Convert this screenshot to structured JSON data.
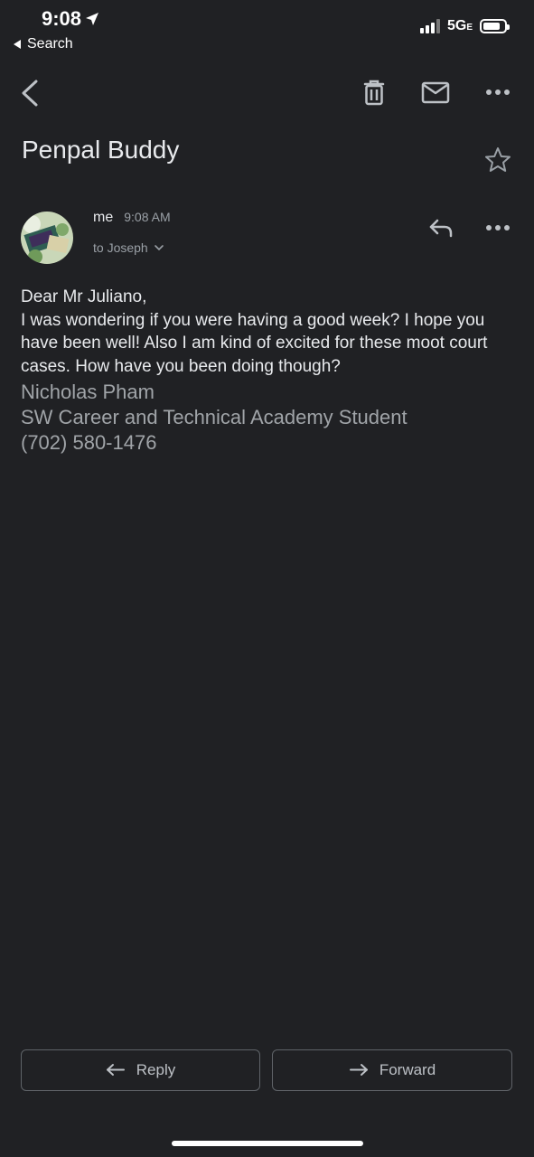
{
  "status_bar": {
    "time": "9:08",
    "back_label": "Search",
    "network": "5G",
    "network_suffix": "E",
    "battery_level": 0.8
  },
  "toolbar": {
    "back_icon": "chevron-left-icon",
    "delete_icon": "trash-icon",
    "mark_unread_icon": "mail-icon",
    "more_icon": "more-horizontal-icon"
  },
  "email": {
    "subject": "Penpal Buddy",
    "sender": "me",
    "time": "9:08 AM",
    "recipient": "to Joseph",
    "body": [
      "Dear Mr Juliano,",
      "I was wondering if you were having a good week? I hope you have been well! Also I am kind of excited for these moot court cases. How have you been doing though?"
    ],
    "signature": [
      "Nicholas Pham",
      "SW Career and Technical Academy Student",
      "(702) 580-1476"
    ]
  },
  "actions": {
    "reply_label": "Reply",
    "forward_label": "Forward"
  },
  "colors": {
    "background": "#202124",
    "text": "#e8eaed",
    "muted": "#9aa0a6",
    "border": "#5f6368"
  }
}
